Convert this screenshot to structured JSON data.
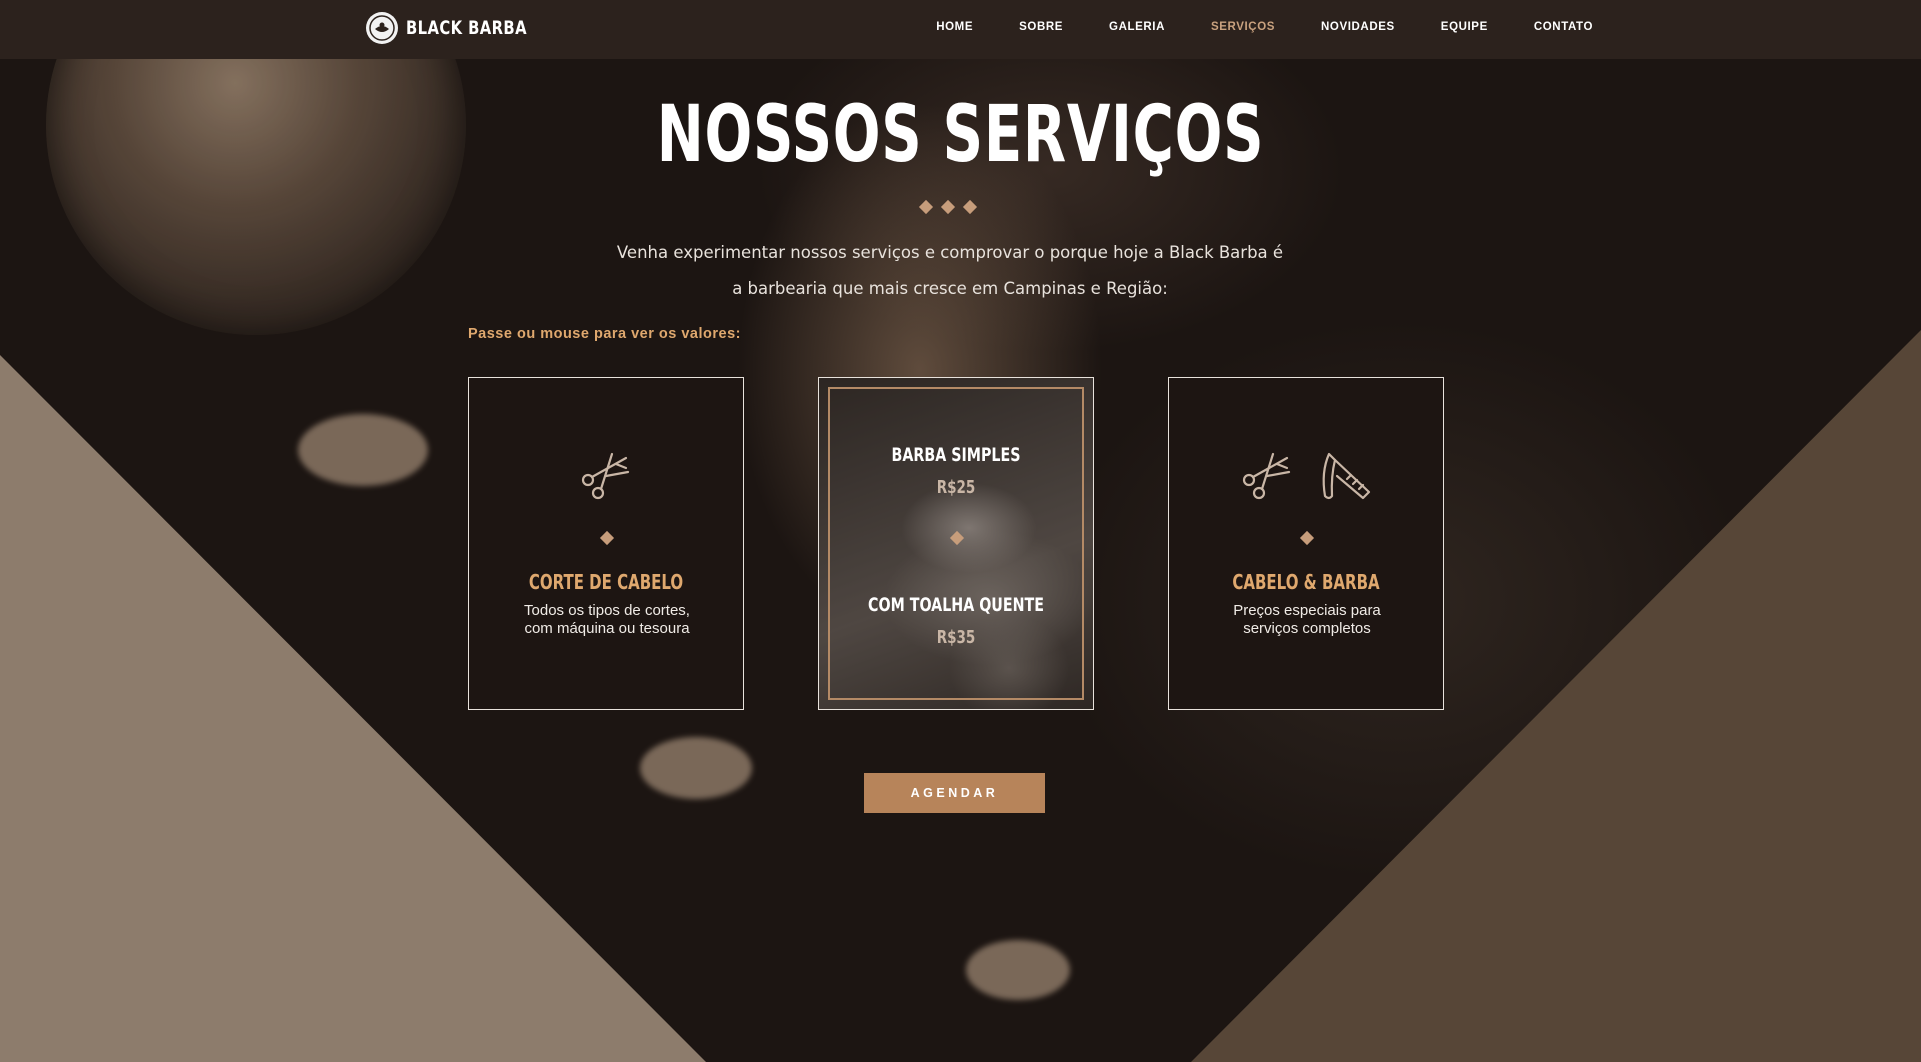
{
  "brand": {
    "name": "BLACK BARBA"
  },
  "nav": {
    "items": [
      {
        "label": "HOME"
      },
      {
        "label": "SOBRE"
      },
      {
        "label": "GALERIA"
      },
      {
        "label": "SERVIÇOS",
        "active": true
      },
      {
        "label": "NOVIDADES"
      },
      {
        "label": "EQUIPE"
      },
      {
        "label": "CONTATO"
      }
    ]
  },
  "hero": {
    "title": "NOSSOS SERVIÇOS",
    "desc_line1": "Venha experimentar nossos serviços e comprovar o porque hoje a Black Barba é",
    "desc_line2": "a barbearia que mais cresce em Campinas e Região:",
    "hint": "Passe ou mouse para ver os valores:"
  },
  "cards": [
    {
      "icon": "scissors-icon",
      "title": "CORTE DE CABELO",
      "desc_line1": "Todos os tipos de cortes,",
      "desc_line2": "com máquina ou tesoura"
    },
    {
      "icon": "beard-photo",
      "prices": [
        {
          "name": "BARBA SIMPLES",
          "value": "R$25"
        },
        {
          "name": "COM TOALHA QUENTE",
          "value": "R$35"
        }
      ]
    },
    {
      "icon": "scissors-razor-icon",
      "title": "CABELO & BARBA",
      "desc_line1": "Preços especiais para",
      "desc_line2": "serviços completos"
    }
  ],
  "cta": {
    "label": "AGENDAR"
  },
  "colors": {
    "accent": "#dfa86e",
    "button": "#b7845a",
    "nav_bg": "#2c221d",
    "active_nav": "#c9a27f"
  }
}
